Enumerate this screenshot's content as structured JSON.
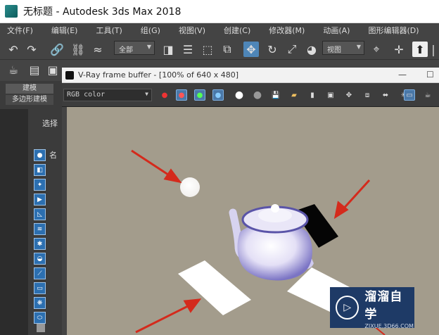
{
  "window": {
    "title": "无标题 - Autodesk 3ds Max 2018"
  },
  "menu": {
    "items": [
      "文件(F)",
      "编辑(E)",
      "工具(T)",
      "组(G)",
      "视图(V)",
      "创建(C)",
      "修改器(M)",
      "动画(A)",
      "图形编辑器(D)"
    ]
  },
  "toolbar": {
    "selection_filter": "全部",
    "ref_coord": "视图"
  },
  "command_panel": {
    "tab_modeling": "建模",
    "tab_poly": "多边形建模",
    "select_label": "选择",
    "name_label": "名"
  },
  "vfb": {
    "title": "V-Ray frame buffer - [100% of 640 x 480]",
    "channel": "RGB color"
  },
  "watermark": {
    "brand": "溜溜自学",
    "url": "ZIXUE.3D66.COM"
  },
  "colors": {
    "render_bg": "#a39c8c",
    "max_ui": "#444444",
    "arrow": "#d42a1c"
  }
}
